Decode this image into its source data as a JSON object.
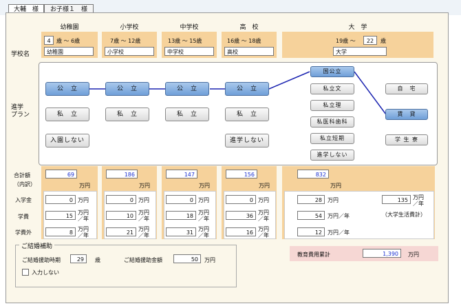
{
  "tabs": [
    {
      "label": "大輔　様"
    },
    {
      "label": "お子様１　様"
    }
  ],
  "columns": [
    {
      "name": "幼稚園",
      "age_from": "4",
      "age_mid": "歳 〜 6歳",
      "school": "幼稚園",
      "total": "69",
      "entrance": "0",
      "tuition": "15",
      "extra": "8"
    },
    {
      "name": "小学校",
      "age_range": "7歳 〜 12歳",
      "school": "小学校",
      "total": "186",
      "entrance": "0",
      "tuition": "10",
      "extra": "21"
    },
    {
      "name": "中学校",
      "age_range": "13歳 〜 15歳",
      "school": "中学校",
      "total": "147",
      "entrance": "0",
      "tuition": "18",
      "extra": "31"
    },
    {
      "name": "高　校",
      "age_range": "16歳 〜 18歳",
      "school": "高校",
      "total": "156",
      "entrance": "0",
      "tuition": "36",
      "extra": "16"
    },
    {
      "name": "大　学",
      "age_from": "19歳 〜",
      "age_to": "22",
      "age_unit": "歳",
      "school": "大学",
      "total": "832",
      "entrance": "28",
      "tuition": "54",
      "extra": "12",
      "living": "135"
    }
  ],
  "labels": {
    "school_name": "学校名",
    "plan_1": "進学",
    "plan_2": "プラン",
    "total_1": "合計額",
    "total_2": "（内訳）",
    "entrance": "入学金",
    "tuition": "学費",
    "extra": "学費外",
    "man_yen": "万円",
    "per_year": "／年",
    "man_yen_per_year": "万円／年",
    "living_note": "（大学生活費計）"
  },
  "plans": {
    "kindergarten": [
      "公　立",
      "私　立",
      "入園しない"
    ],
    "elementary": [
      "公　立",
      "私　立"
    ],
    "junior_high": [
      "公　立",
      "私　立"
    ],
    "high_school": [
      "公　立",
      "私　立",
      "進学しない"
    ],
    "university": [
      "国公立",
      "私立文",
      "私立理",
      "私医科歯科",
      "私立短期",
      "進学しない"
    ],
    "residence": [
      "自　宅",
      "賃　貸",
      "学 生 寮"
    ]
  },
  "kekkon": {
    "title": "ご結婚補助",
    "timing_label": "ご結婚援助時期",
    "timing_value": "29",
    "timing_unit": "歳",
    "amount_label": "ご結婚援助金額",
    "amount_value": "50",
    "amount_unit": "万円",
    "checkbox_label": "入力しない"
  },
  "education_total": {
    "label": "教育費用累計",
    "value": "1,390",
    "unit": "万円"
  },
  "colors": {
    "selected": "#6f9fd8",
    "band": "#f6d29b",
    "total_bg": "#f6d7d4",
    "value_blue": "#1a2fd0"
  }
}
